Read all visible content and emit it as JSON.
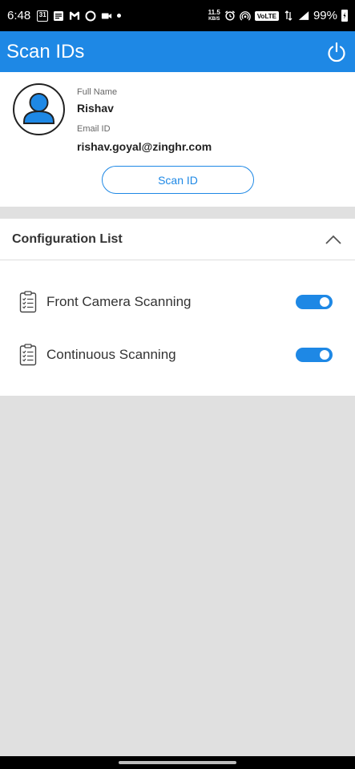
{
  "status_bar": {
    "time": "6:48",
    "calendar_day": "31",
    "speed_value": "11.5",
    "speed_unit": "KB/S",
    "volte": "VoLTE",
    "battery": "99%"
  },
  "app_bar": {
    "title": "Scan IDs",
    "power_icon": "power-icon"
  },
  "profile": {
    "full_name_label": "Full Name",
    "full_name": "Rishav",
    "email_label": "Email ID",
    "email": "rishav.goyal@zinghr.com",
    "scan_button": "Scan ID"
  },
  "config": {
    "title": "Configuration List",
    "items": [
      {
        "label": "Front Camera Scanning",
        "enabled": true
      },
      {
        "label": "Continuous Scanning",
        "enabled": true
      }
    ]
  },
  "colors": {
    "primary": "#1e88e5",
    "background": "#e0e0e0"
  }
}
